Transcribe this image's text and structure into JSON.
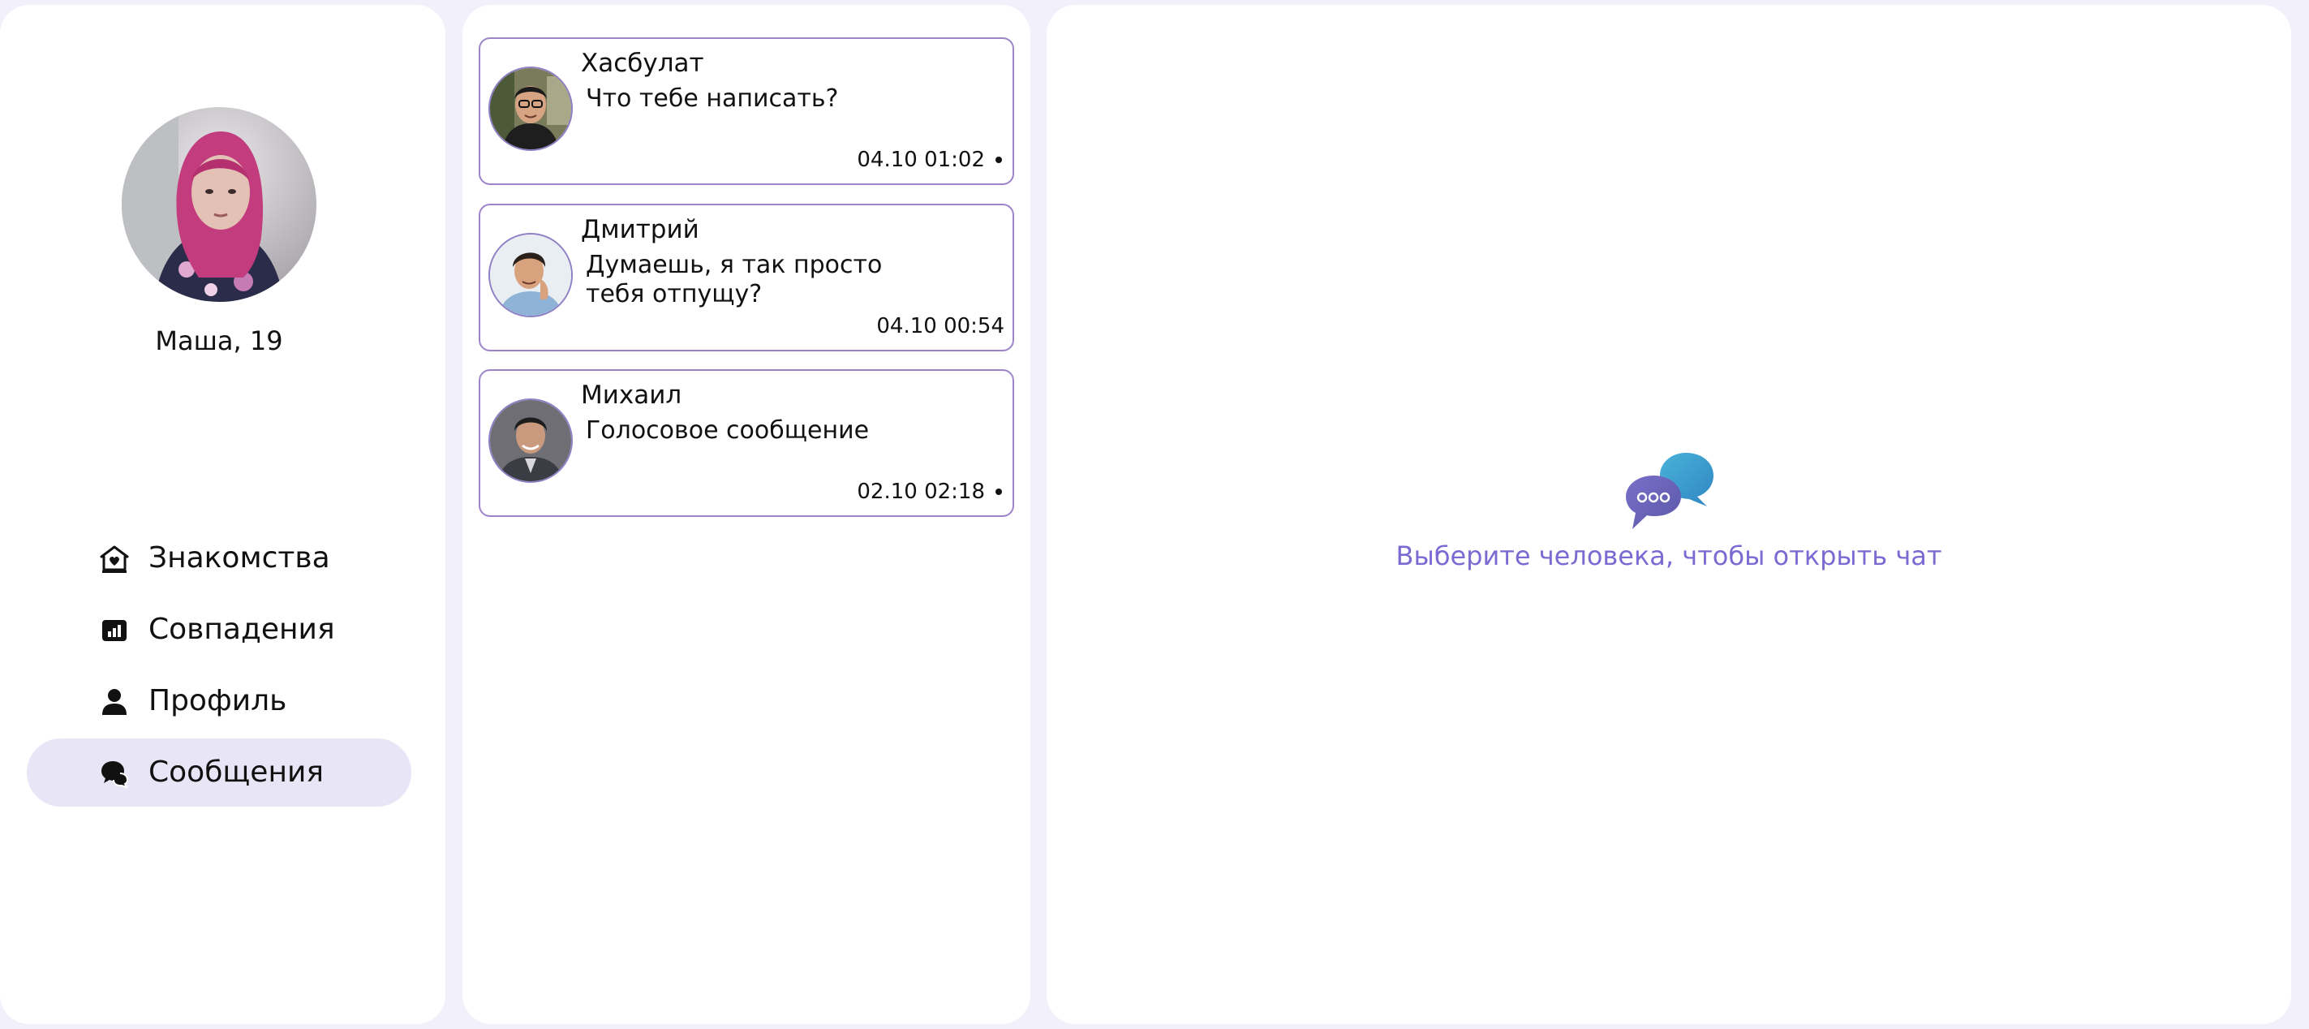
{
  "profile": {
    "name_age": "Маша, 19"
  },
  "nav": {
    "items": [
      {
        "label": "Знакомства",
        "icon": "home-heart-icon",
        "active": false
      },
      {
        "label": "Совпадения",
        "icon": "chart-icon",
        "active": false
      },
      {
        "label": "Профиль",
        "icon": "user-icon",
        "active": false
      },
      {
        "label": "Сообщения",
        "icon": "chat-bubbles-icon",
        "active": true
      }
    ]
  },
  "chats": [
    {
      "name": "Хасбулат",
      "message": "Что тебе написать?",
      "time": "04.10 01:02",
      "unread": true,
      "avatar": "avatar-khasbulat"
    },
    {
      "name": "Дмитрий",
      "message": "Думаешь, я так просто тебя отпущу?",
      "time": "04.10 00:54",
      "unread": false,
      "avatar": "avatar-dmitry"
    },
    {
      "name": "Михаил",
      "message": "Голосовое сообщение",
      "time": "02.10 02:18",
      "unread": true,
      "avatar": "avatar-mikhail"
    }
  ],
  "main": {
    "empty_text": "Выберите человека, чтобы открыть чат",
    "empty_icon": "chat-bubbles-icon"
  },
  "colors": {
    "background": "#f1f0fb",
    "active_nav": "#e7e5f6",
    "card_border": "#9d84c9",
    "accent_text": "#7a6ad2",
    "bubble_front": "#6b64b8",
    "bubble_back": "#3aa0cf"
  }
}
